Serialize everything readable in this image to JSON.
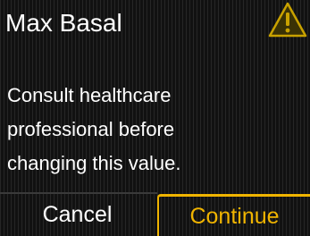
{
  "header": {
    "title": "Max Basal",
    "warning_icon": "warning-triangle-icon",
    "warning_color": "#c9a200"
  },
  "message": {
    "lines": [
      "Consult healthcare",
      "professional before",
      "changing this value."
    ]
  },
  "buttons": {
    "cancel_label": "Cancel",
    "continue_label": "Continue",
    "accent_color": "#f0b400"
  }
}
